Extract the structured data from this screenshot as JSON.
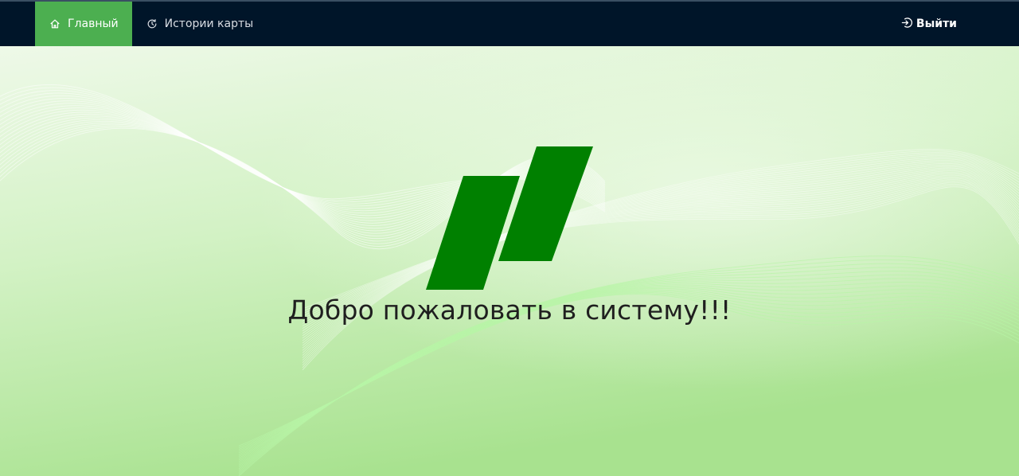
{
  "nav": {
    "items": [
      {
        "label": "Главный",
        "icon": "home-icon",
        "active": true
      },
      {
        "label": "Истории карты",
        "icon": "history-icon",
        "active": false
      }
    ],
    "logout": {
      "label": "Выйти",
      "icon": "logout-icon"
    }
  },
  "hero": {
    "logo": "logo-icon",
    "welcome_text": "Добро пожаловать в систему!!!"
  },
  "colors": {
    "navbar_bg": "#001529",
    "active_tab": "#4caf50",
    "logo_green": "#008000",
    "background": "#c9eeb8"
  }
}
